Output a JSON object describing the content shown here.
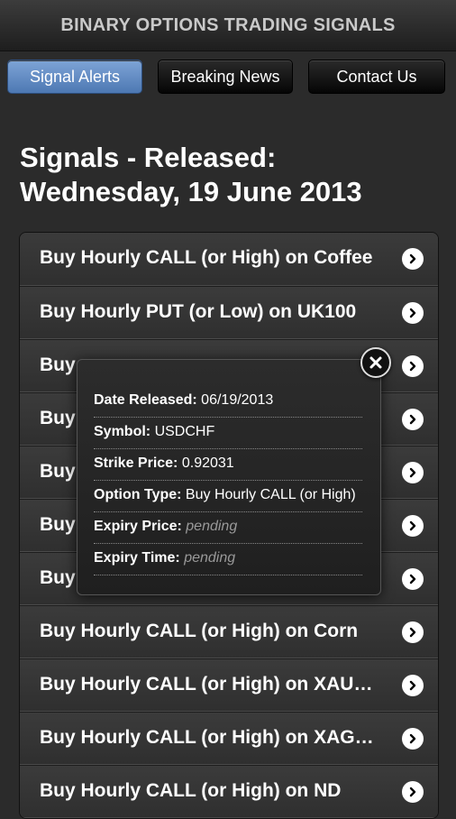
{
  "app": {
    "title": "BINARY OPTIONS TRADING SIGNALS"
  },
  "tabs": [
    {
      "label": "Signal Alerts",
      "active": true
    },
    {
      "label": "Breaking News",
      "active": false
    },
    {
      "label": "Contact Us",
      "active": false
    }
  ],
  "heading": {
    "line1": "Signals - Released:",
    "line2": "Wednesday, 19 June 2013"
  },
  "signals": [
    {
      "label": "Buy Hourly CALL (or High) on Coffee"
    },
    {
      "label": "Buy Hourly PUT (or Low) on UK100"
    },
    {
      "label": "Buy"
    },
    {
      "label": "Buy"
    },
    {
      "label": "Buy"
    },
    {
      "label": "Buy"
    },
    {
      "label": "Buy"
    },
    {
      "label": "Buy Hourly CALL (or High) on Corn"
    },
    {
      "label": "Buy Hourly CALL (or High) on XAUU..."
    },
    {
      "label": "Buy Hourly CALL (or High) on XAGU..."
    },
    {
      "label": "Buy Hourly CALL (or High) on ND"
    }
  ],
  "popup": {
    "date_label": "Date Released:",
    "date_value": "06/19/2013",
    "symbol_label": "Symbol:",
    "symbol_value": "USDCHF",
    "strike_label": "Strike Price:",
    "strike_value": "0.92031",
    "type_label": "Option Type:",
    "type_value": "Buy Hourly CALL (or High)",
    "expiry_price_label": "Expiry Price:",
    "expiry_price_value": "pending",
    "expiry_time_label": "Expiry Time:",
    "expiry_time_value": "pending"
  },
  "icons": {
    "row_arrow": "chevron-right-icon",
    "close": "close-icon"
  },
  "colors": {
    "active_tab": "#5b86c3",
    "background": "#2b2b2b"
  }
}
